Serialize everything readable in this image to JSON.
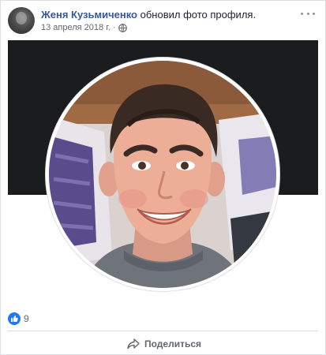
{
  "post": {
    "author_name": "Женя Кузьмиченко",
    "action": "обновил фото профиля.",
    "date": "13 апреля 2018 г.",
    "date_separator": "·",
    "privacy_icon": "globe-icon",
    "menu_icon": "more-options-icon"
  },
  "photo": {
    "description_icon": "profile-photo"
  },
  "reactions": {
    "icon": "like-icon",
    "count": "9"
  },
  "actions": {
    "share_label": "Поделиться",
    "share_icon": "share-arrow-icon"
  },
  "colors": {
    "link": "#365899",
    "text": "#1d2129",
    "meta": "#616770",
    "like_blue": "#2078f4",
    "cover": "#1b1c1d"
  }
}
